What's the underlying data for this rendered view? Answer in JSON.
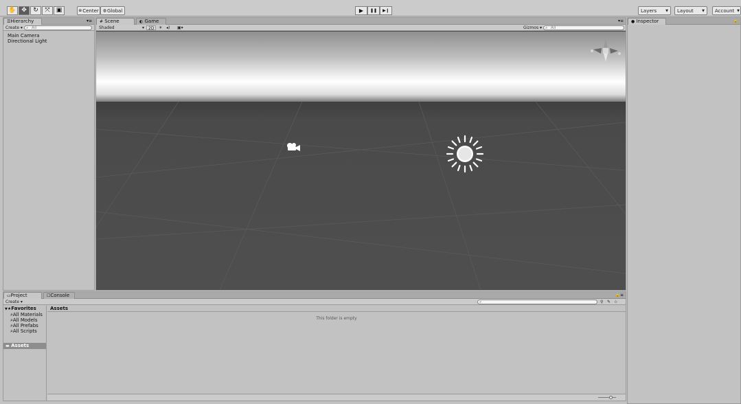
{
  "toolbar": {
    "tools": [
      {
        "icon": "hand-icon",
        "glyph": "✋"
      },
      {
        "icon": "move-icon",
        "glyph": "✥"
      },
      {
        "icon": "rotate-icon",
        "glyph": "↻"
      },
      {
        "icon": "scale-icon",
        "glyph": "⤧"
      },
      {
        "icon": "rect-icon",
        "glyph": "▣"
      }
    ],
    "pivot_label": "Center",
    "space_label": "Global",
    "play_glyph": "▶",
    "pause_glyph": "❚❚",
    "step_glyph": "▶❙",
    "layers_label": "Layers",
    "layout_label": "Layout",
    "account_label": "Account"
  },
  "hierarchy": {
    "tab_label": "Hierarchy",
    "create_label": "Create",
    "search_placeholder": "All",
    "items": [
      "Main Camera",
      "Directional Light"
    ]
  },
  "scene": {
    "tabs": [
      {
        "label": "Scene",
        "icon": "scene-icon"
      },
      {
        "label": "Game",
        "icon": "game-icon"
      }
    ],
    "shading_mode": "Shaded",
    "mode_2d_label": "2D",
    "gizmos_label": "Gizmos",
    "search_placeholder": "All",
    "objects": [
      {
        "name": "camera-gizmo-icon"
      },
      {
        "name": "sun-gizmo-icon"
      }
    ]
  },
  "inspector": {
    "tab_label": "Inspector"
  },
  "project": {
    "tabs": [
      {
        "label": "Project"
      },
      {
        "label": "Console"
      }
    ],
    "create_label": "Create",
    "favorites_label": "Favorites",
    "favorites": [
      "All Materials",
      "All Models",
      "All Prefabs",
      "All Scripts"
    ],
    "assets_label": "Assets",
    "breadcrumb": "Assets",
    "empty_message": "This folder is empty"
  },
  "colors": {
    "sky_top": "#8f8f8f",
    "sky_horizon": "#ffffff",
    "ground": "#4d4d4d",
    "panel_bg": "#c2c2c2",
    "selection": "#8d8d8d"
  }
}
